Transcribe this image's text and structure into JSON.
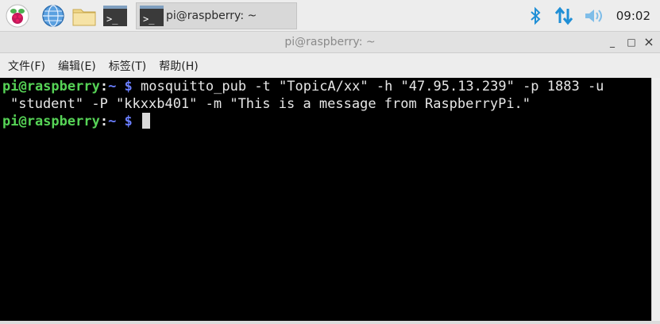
{
  "taskbar": {
    "apps": [
      {
        "name": "raspberry-menu-icon"
      },
      {
        "name": "web-browser-icon"
      },
      {
        "name": "file-manager-icon"
      },
      {
        "name": "terminal-launcher-icon"
      }
    ],
    "task_button": {
      "label": "pi@raspberry: ~"
    },
    "tray": {
      "bluetooth": "bluetooth-icon",
      "network": "network-arrows-icon",
      "volume": "volume-icon"
    },
    "clock": "09:02",
    "accent": "#1f8fd6"
  },
  "window": {
    "title": "pi@raspberry: ~",
    "controls": {
      "minimize": "_",
      "maximize": "□",
      "close": "×"
    }
  },
  "menu": {
    "items": [
      "文件(F)",
      "编辑(E)",
      "标签(T)",
      "帮助(H)"
    ]
  },
  "terminal": {
    "prompt_user": "pi@raspberry",
    "prompt_colon": ":",
    "prompt_path": "~ $",
    "command_line1": " mosquitto_pub -t \"TopicA/xx\" -h \"47.95.13.239\" -p 1883 -u",
    "command_line2": "\"student\" -P \"kkxxb401\" -m \"This is a message from RaspberryPi.\""
  }
}
